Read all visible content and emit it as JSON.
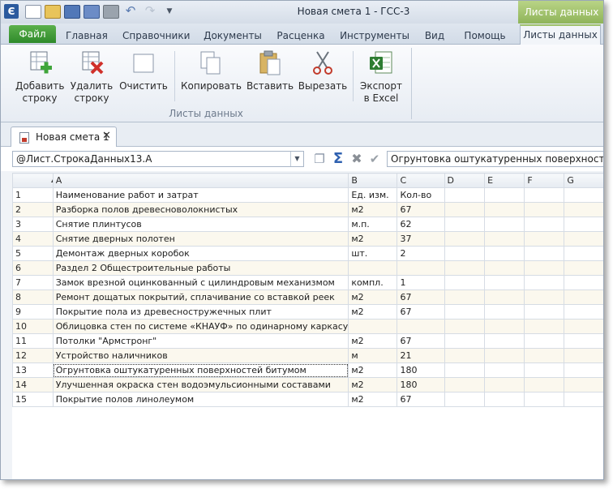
{
  "window": {
    "title": "Новая смета 1 - ГСС-3",
    "context_tab_header": "Листы данных"
  },
  "quick_access": {
    "icons": [
      "new-file-icon",
      "open-folder-icon",
      "save-icon",
      "save-all-icon",
      "print-icon",
      "undo-icon",
      "redo-icon",
      "customize-icon"
    ]
  },
  "ribbon_tabs": [
    {
      "label": "Файл"
    },
    {
      "label": "Главная"
    },
    {
      "label": "Справочники"
    },
    {
      "label": "Документы"
    },
    {
      "label": "Расценка"
    },
    {
      "label": "Инструменты"
    },
    {
      "label": "Вид"
    },
    {
      "label": "Помощь"
    },
    {
      "label": "Листы данных"
    }
  ],
  "ribbon": {
    "group_label": "Листы данных",
    "add_row": {
      "line1": "Добавить",
      "line2": "строку"
    },
    "delete_row": {
      "line1": "Удалить",
      "line2": "строку"
    },
    "clear": {
      "line1": "Очистить"
    },
    "copy": {
      "line1": "Копировать"
    },
    "paste": {
      "line1": "Вставить"
    },
    "cut": {
      "line1": "Вырезать"
    },
    "export": {
      "line1": "Экспорт",
      "line2": "в Excel"
    }
  },
  "document_tab": {
    "label": "Новая смета 1",
    "close": "✕"
  },
  "formula_bar": {
    "name_box": "@Лист.СтрокаДанных13.А",
    "value": "Огрунтовка  оштукатуренных поверхностей битумом"
  },
  "grid": {
    "columns": [
      "A",
      "B",
      "C",
      "D",
      "E",
      "F",
      "G"
    ],
    "rows": [
      {
        "n": "1",
        "a": "Наименование работ и затрат",
        "b": "Ед. изм.",
        "c": "Кол-во"
      },
      {
        "n": "2",
        "a": "Разборка  полов  древесноволокнистых",
        "b": "м2",
        "c": "67"
      },
      {
        "n": "3",
        "a": "Снятие плинтусов",
        "b": "м.п.",
        "c": "62"
      },
      {
        "n": "4",
        "a": "Снятие дверных полотен",
        "b": "м2",
        "c": "37"
      },
      {
        "n": "5",
        "a": "Демонтаж дверных коробок",
        "b": "шт.",
        "c": "2"
      },
      {
        "n": "6",
        "a": "Раздел 2 Общестроительные работы",
        "b": "",
        "c": ""
      },
      {
        "n": "7",
        "a": "Замок врезной оцинкованный с цилиндровым механизмом",
        "b": "компл.",
        "c": "1"
      },
      {
        "n": "8",
        "a": "Ремонт дощатых покрытий, сплачивание со вставкой реек",
        "b": "м2",
        "c": "67"
      },
      {
        "n": "9",
        "a": "Покрытие пола из древесностружечных плит",
        "b": "м2",
        "c": "67"
      },
      {
        "n": "10",
        "a": "Облицовка стен по системе «КНАУФ» по одинарному каркасу",
        "b": "",
        "c": ""
      },
      {
        "n": "11",
        "a": "Потолки \"Армстронг\"",
        "b": "м2",
        "c": "67"
      },
      {
        "n": "12",
        "a": "Устройство наличников",
        "b": "м",
        "c": "21"
      },
      {
        "n": "13",
        "a": "Огрунтовка  оштукатуренных поверхностей битумом",
        "b": "м2",
        "c": "180"
      },
      {
        "n": "14",
        "a": "Улучшенная окраска стен водоэмульсионными составами",
        "b": "м2",
        "c": "180"
      },
      {
        "n": "15",
        "a": "Покрытие полов линолеумом",
        "b": "м2",
        "c": "67"
      }
    ]
  },
  "colors": {
    "file_tab": "#3a9a34",
    "context_tab": "#9fc16a",
    "row_stripe": "#fbf8ee",
    "sum_icon": "#2f61b0"
  }
}
